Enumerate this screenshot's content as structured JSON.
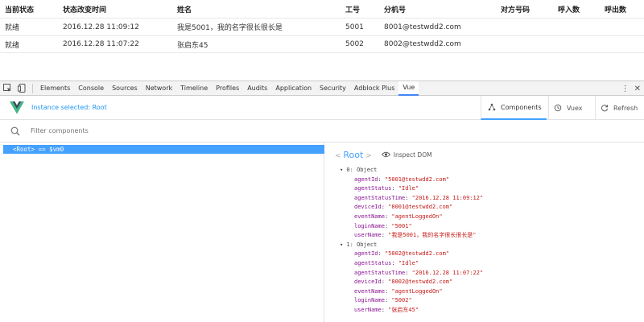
{
  "page": {
    "columns": [
      "当前状态",
      "状态改变时间",
      "姓名",
      "工号",
      "分机号",
      "对方号码",
      "呼入数",
      "呼出数"
    ],
    "rows": [
      [
        "就绪",
        "2016.12.28 11:09:12",
        "我是5001，我的名字很长很长是",
        "5001",
        "8001@testwdd2.com",
        "",
        "",
        ""
      ],
      [
        "就绪",
        "2016.12.28 11:07:22",
        "张启东45",
        "5002",
        "8002@testwdd2.com",
        "",
        "",
        ""
      ]
    ]
  },
  "devtools": {
    "tabs": [
      "Elements",
      "Console",
      "Sources",
      "Network",
      "Timeline",
      "Profiles",
      "Audits",
      "Application",
      "Security",
      "Adblock Plus",
      "Vue"
    ],
    "active_tab": "Vue",
    "vue": {
      "instance_selected": "Instance selected: Root",
      "nav": {
        "components": "Components",
        "vuex": "Vuex",
        "refresh": "Refresh"
      },
      "filter_placeholder": "Filter components",
      "tree_row": "<Root> == $vm0",
      "root_label": "Root",
      "inspect_dom": "Inspect DOM",
      "objects": [
        {
          "header": "▾ 0: Object",
          "props": [
            {
              "k": "agentId",
              "v": "\"5001@testwdd2.com\""
            },
            {
              "k": "agentStatus",
              "v": "\"Idle\""
            },
            {
              "k": "agentStatusTime",
              "v": "\"2016.12.28 11:09:12\""
            },
            {
              "k": "deviceId",
              "v": "\"8001@testwdd2.com\""
            },
            {
              "k": "eventName",
              "v": "\"agentLoggedOn\""
            },
            {
              "k": "loginName",
              "v": "\"5001\""
            },
            {
              "k": "userName",
              "v": "\"我是5001，我的名字很长很长是\""
            }
          ]
        },
        {
          "header": "▾ 1: Object",
          "props": [
            {
              "k": "agentId",
              "v": "\"5002@testwdd2.com\""
            },
            {
              "k": "agentStatus",
              "v": "\"Idle\""
            },
            {
              "k": "agentStatusTime",
              "v": "\"2016.12.28 11:07:22\""
            },
            {
              "k": "deviceId",
              "v": "\"8002@testwdd2.com\""
            },
            {
              "k": "eventName",
              "v": "\"agentLoggedOn\""
            },
            {
              "k": "loginName",
              "v": "\"5002\""
            },
            {
              "k": "userName",
              "v": "\"张启东45\""
            }
          ]
        }
      ]
    }
  },
  "colors": {
    "accent": "#44a1ff",
    "instance_text": "#2196f3",
    "prop_key": "#881391",
    "prop_string": "#c41a16",
    "vue_green": "#41b883",
    "vue_dark": "#35495e"
  }
}
